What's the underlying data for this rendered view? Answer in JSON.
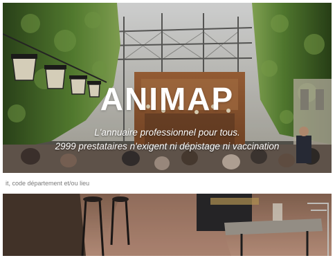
{
  "hero": {
    "brand": "ANIMAP",
    "tagline_line1": "L'annuaire professionnel pour tous.",
    "tagline_line2": "2999 prestataires n'exigent ni dépistage ni vaccination"
  },
  "search": {
    "placeholder": "it, code département et/ou lieu",
    "value": ""
  },
  "colors": {
    "overlay_text": "#ffffff",
    "search_background": "#ffffff",
    "placeholder": "#7a7a7a"
  },
  "icons": {
    "background": "restaurant-photo"
  }
}
